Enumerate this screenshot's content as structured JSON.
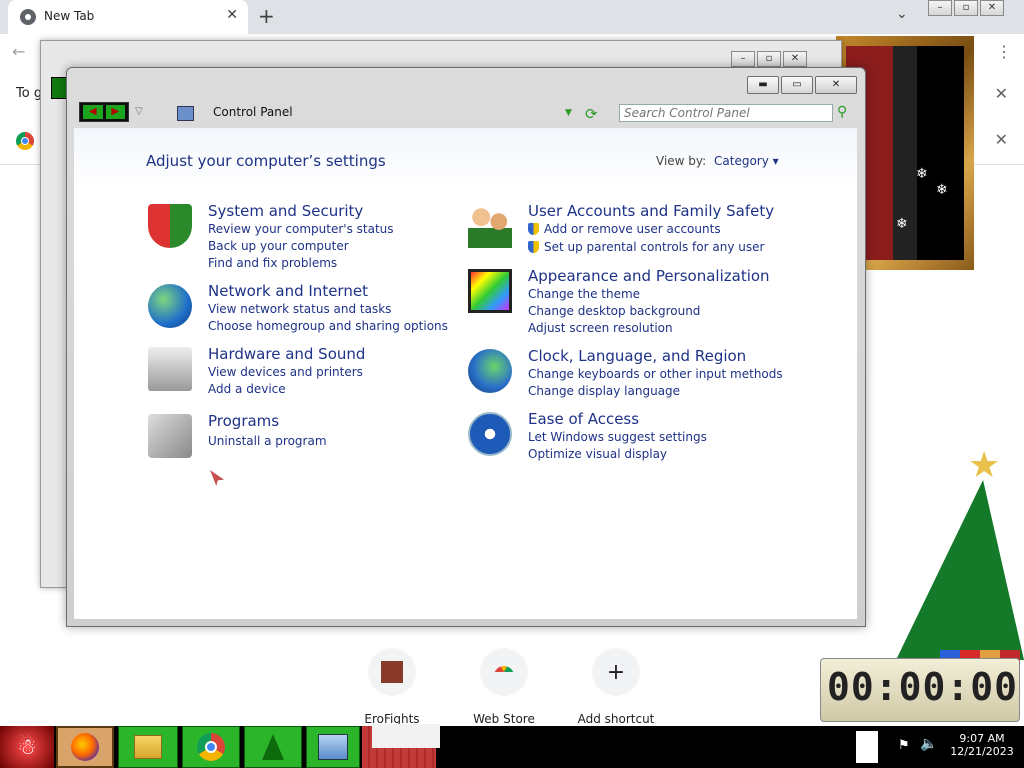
{
  "chrome": {
    "tab_title": "New Tab",
    "tab_close": "✕",
    "new_tab": "+",
    "infobar_text": "To g",
    "infobar_close": "✕",
    "infobar2_close": "✕",
    "menu": "⋮",
    "back": "←",
    "caret": "⌄",
    "shortcuts": [
      {
        "label": "EroFights"
      },
      {
        "label": "Web Store"
      },
      {
        "label": "Add shortcut",
        "icon": "+"
      }
    ]
  },
  "control_panel": {
    "address": "Control Panel",
    "search_placeholder": "Search Control Panel",
    "heading": "Adjust your computer’s settings",
    "view_by_label": "View by:",
    "view_by_value": "Category ▾",
    "categories": [
      {
        "title": "System and Security",
        "icon": "shield-icon",
        "links": [
          "Review your computer's status",
          "Back up your computer",
          "Find and fix problems"
        ]
      },
      {
        "title": "Network and Internet",
        "icon": "network-globe-icon",
        "links": [
          "View network status and tasks",
          "Choose homegroup and sharing options"
        ]
      },
      {
        "title": "Hardware and Sound",
        "icon": "printer-icon",
        "links": [
          "View devices and printers",
          "Add a device"
        ]
      },
      {
        "title": "Programs",
        "icon": "programs-icon",
        "links": [
          "Uninstall a program"
        ]
      },
      {
        "title": "User Accounts and Family Safety",
        "icon": "users-icon",
        "links": [
          "Add or remove user accounts",
          "Set up parental controls for any user"
        ]
      },
      {
        "title": "Appearance and Personalization",
        "icon": "appearance-icon",
        "links": [
          "Change the theme",
          "Change desktop background",
          "Adjust screen resolution"
        ]
      },
      {
        "title": "Clock, Language, and Region",
        "icon": "clock-globe-icon",
        "links": [
          "Change keyboards or other input methods",
          "Change display language"
        ]
      },
      {
        "title": "Ease of Access",
        "icon": "ease-of-access-icon",
        "links": [
          "Let Windows suggest settings",
          "Optimize visual display"
        ]
      }
    ]
  },
  "desktop": {
    "clock_widget": "00:00:00"
  },
  "taskbar": {
    "time": "9:07 AM",
    "date": "12/21/2023"
  }
}
